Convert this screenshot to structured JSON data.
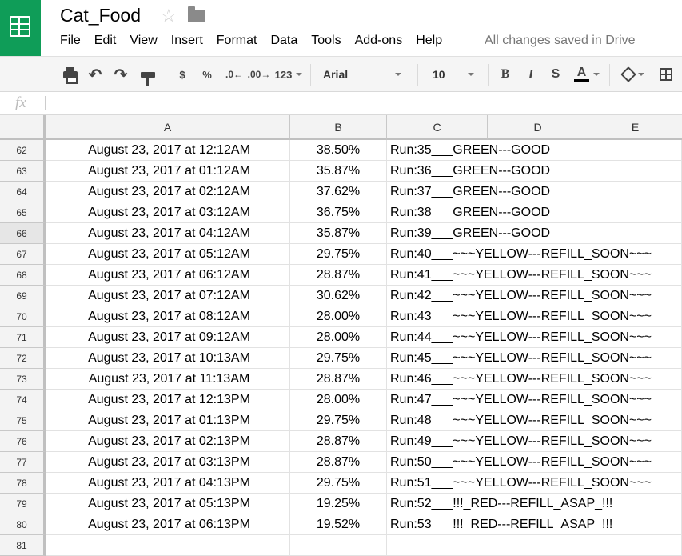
{
  "app": {
    "title": "Cat_Food",
    "save_status": "All changes saved in Drive",
    "menu": [
      "File",
      "Edit",
      "View",
      "Insert",
      "Format",
      "Data",
      "Tools",
      "Add-ons",
      "Help"
    ]
  },
  "toolbar": {
    "currency": "$",
    "percent": "%",
    "decrease_decimal": ".0←",
    "increase_decimal": ".00→",
    "more_formats": "123",
    "font": "Arial",
    "font_size": "10",
    "bold": "B",
    "italic": "I",
    "strikethrough": "S",
    "text_color": "A"
  },
  "formula_bar": {
    "fx": "fx",
    "value": ""
  },
  "columns": [
    "A",
    "B",
    "C",
    "D",
    "E"
  ],
  "rows": [
    {
      "num": "62",
      "a": "August 23, 2017 at 12:12AM",
      "b": "38.50%",
      "c": "Run:35___GREEN---GOOD"
    },
    {
      "num": "63",
      "a": "August 23, 2017 at 01:12AM",
      "b": "35.87%",
      "c": "Run:36___GREEN---GOOD"
    },
    {
      "num": "64",
      "a": "August 23, 2017 at 02:12AM",
      "b": "37.62%",
      "c": "Run:37___GREEN---GOOD"
    },
    {
      "num": "65",
      "a": "August 23, 2017 at 03:12AM",
      "b": "36.75%",
      "c": "Run:38___GREEN---GOOD"
    },
    {
      "num": "66",
      "a": "August 23, 2017 at 04:12AM",
      "b": "35.87%",
      "c": "Run:39___GREEN---GOOD"
    },
    {
      "num": "67",
      "a": "August 23, 2017 at 05:12AM",
      "b": "29.75%",
      "c": "Run:40___~~~YELLOW---REFILL_SOON~~~"
    },
    {
      "num": "68",
      "a": "August 23, 2017 at 06:12AM",
      "b": "28.87%",
      "c": "Run:41___~~~YELLOW---REFILL_SOON~~~"
    },
    {
      "num": "69",
      "a": "August 23, 2017 at 07:12AM",
      "b": "30.62%",
      "c": "Run:42___~~~YELLOW---REFILL_SOON~~~"
    },
    {
      "num": "70",
      "a": "August 23, 2017 at 08:12AM",
      "b": "28.00%",
      "c": "Run:43___~~~YELLOW---REFILL_SOON~~~"
    },
    {
      "num": "71",
      "a": "August 23, 2017 at 09:12AM",
      "b": "28.00%",
      "c": "Run:44___~~~YELLOW---REFILL_SOON~~~"
    },
    {
      "num": "72",
      "a": "August 23, 2017 at 10:13AM",
      "b": "29.75%",
      "c": "Run:45___~~~YELLOW---REFILL_SOON~~~"
    },
    {
      "num": "73",
      "a": "August 23, 2017 at 11:13AM",
      "b": "28.87%",
      "c": "Run:46___~~~YELLOW---REFILL_SOON~~~"
    },
    {
      "num": "74",
      "a": "August 23, 2017 at 12:13PM",
      "b": "28.00%",
      "c": "Run:47___~~~YELLOW---REFILL_SOON~~~"
    },
    {
      "num": "75",
      "a": "August 23, 2017 at 01:13PM",
      "b": "29.75%",
      "c": "Run:48___~~~YELLOW---REFILL_SOON~~~"
    },
    {
      "num": "76",
      "a": "August 23, 2017 at 02:13PM",
      "b": "28.87%",
      "c": "Run:49___~~~YELLOW---REFILL_SOON~~~"
    },
    {
      "num": "77",
      "a": "August 23, 2017 at 03:13PM",
      "b": "28.87%",
      "c": "Run:50___~~~YELLOW---REFILL_SOON~~~"
    },
    {
      "num": "78",
      "a": "August 23, 2017 at 04:13PM",
      "b": "29.75%",
      "c": "Run:51___~~~YELLOW---REFILL_SOON~~~"
    },
    {
      "num": "79",
      "a": "August 23, 2017 at 05:13PM",
      "b": "19.25%",
      "c": "Run:52___!!!_RED---REFILL_ASAP_!!!"
    },
    {
      "num": "80",
      "a": "August 23, 2017 at 06:13PM",
      "b": "19.52%",
      "c": "Run:53___!!!_RED---REFILL_ASAP_!!!"
    },
    {
      "num": "81",
      "a": "",
      "b": "",
      "c": ""
    }
  ],
  "selected_row": "66",
  "colors": {
    "brand_green": "#0f9d58",
    "header_bg": "#f3f3f3",
    "toolbar_bg": "#f5f5f5"
  },
  "icons": [
    "sheets-logo-icon",
    "star-icon",
    "folder-icon",
    "print-icon",
    "undo-icon",
    "redo-icon",
    "paint-format-icon",
    "fill-color-icon",
    "borders-icon",
    "fx-icon"
  ]
}
